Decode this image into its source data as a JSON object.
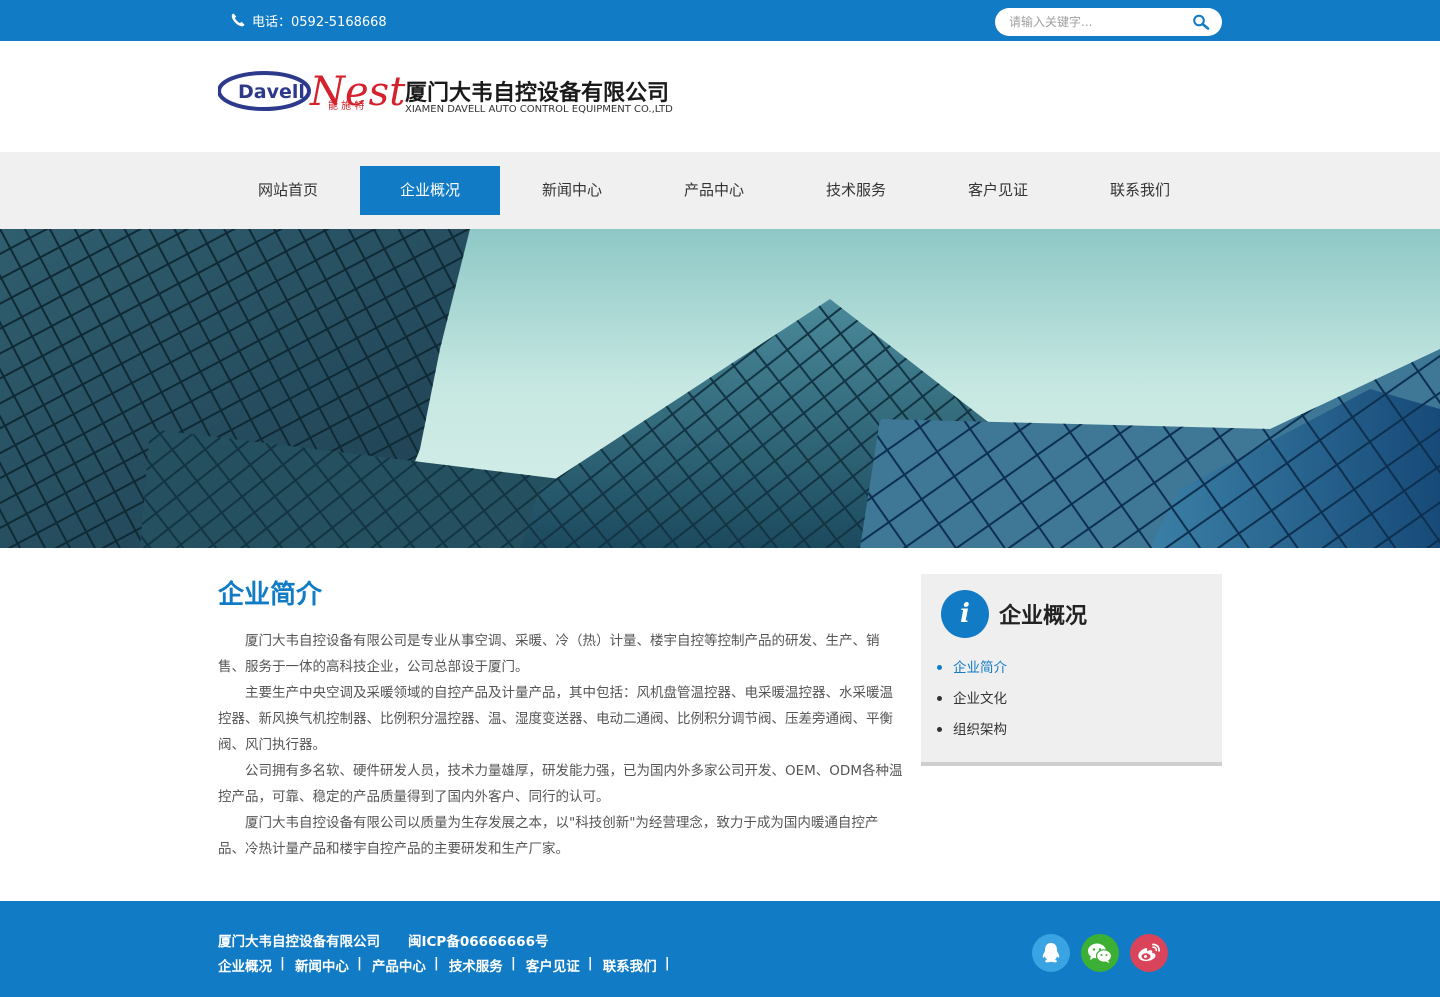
{
  "topbar": {
    "phone_text": "电话：0592-5168668",
    "search_placeholder": "请输入关键字..."
  },
  "header": {
    "logo_brand_left": "Davell",
    "logo_brand_right": "Nest",
    "logo_brand_cn": "能 施 特",
    "company_cn": "厦门大韦自控设备有限公司",
    "company_en": "XIAMEN DAVELL AUTO CONTROL EQUIPMENT CO.,LTD"
  },
  "nav": {
    "items": [
      {
        "label": "网站首页"
      },
      {
        "label": "企业概况"
      },
      {
        "label": "新闻中心"
      },
      {
        "label": "产品中心"
      },
      {
        "label": "技术服务"
      },
      {
        "label": "客户见证"
      },
      {
        "label": "联系我们"
      }
    ],
    "active_index": 1
  },
  "main": {
    "title": "企业简介",
    "paragraphs": [
      "厦门大韦自控设备有限公司是专业从事空调、采暖、冷（热）计量、楼宇自控等控制产品的研发、生产、销售、服务于一体的高科技企业，公司总部设于厦门。",
      "主要生产中央空调及采暖领域的自控产品及计量产品，其中包括：风机盘管温控器、电采暖温控器、水采暖温控器、新风换气机控制器、比例积分温控器、温、湿度变送器、电动二通阀、比例积分调节阀、压差旁通阀、平衡阀、风门执行器。",
      "公司拥有多名软、硬件研发人员，技术力量雄厚，研发能力强，已为国内外多家公司开发、OEM、ODM各种温控产品，可靠、稳定的产品质量得到了国内外客户、同行的认可。",
      "厦门大韦自控设备有限公司以质量为生存发展之本，以\"科技创新\"为经营理念，致力于成为国内暖通自控产品、冷热计量产品和楼宇自控产品的主要研发和生产厂家。"
    ]
  },
  "sidebar": {
    "icon_letter": "i",
    "title": "企业概况",
    "items": [
      {
        "label": "企业简介"
      },
      {
        "label": "企业文化"
      },
      {
        "label": "组织架构"
      }
    ],
    "active_index": 0
  },
  "footer": {
    "company": "厦门大韦自控设备有限公司",
    "icp": "闽ICP备06666666号",
    "links": [
      {
        "label": "企业概况"
      },
      {
        "label": "新闻中心"
      },
      {
        "label": "产品中心"
      },
      {
        "label": "技术服务"
      },
      {
        "label": "客户见证"
      },
      {
        "label": "联系我们"
      }
    ],
    "separator": "|",
    "social": [
      {
        "icon": "qq-icon",
        "color": "#3aa3e3"
      },
      {
        "icon": "wechat-icon",
        "color": "#3cb034"
      },
      {
        "icon": "weibo-icon",
        "color": "#d9445a"
      }
    ]
  },
  "colors": {
    "primary": "#117bc6",
    "nav_bg": "#f0f0f0",
    "sidebar_bg": "#efefef"
  }
}
